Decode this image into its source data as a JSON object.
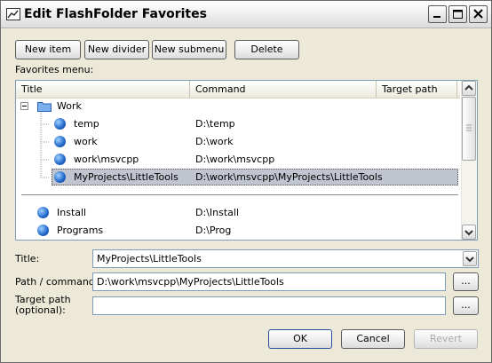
{
  "window": {
    "title": "Edit FlashFolder Favorites"
  },
  "toolbar": {
    "new_item": "New item",
    "new_divider": "New divider",
    "new_submenu": "New submenu",
    "delete": "Delete"
  },
  "favorites_label": "Favorites menu:",
  "list": {
    "columns": [
      "Title",
      "Command",
      "Target path"
    ],
    "rows": [
      {
        "title": "Work",
        "command": "",
        "type": "folder",
        "level": 0,
        "expanded": true
      },
      {
        "title": "temp",
        "command": "D:\\temp",
        "type": "item",
        "level": 1
      },
      {
        "title": "work",
        "command": "D:\\work",
        "type": "item",
        "level": 1
      },
      {
        "title": "work\\msvcpp",
        "command": "D:\\work\\msvcpp",
        "type": "item",
        "level": 1
      },
      {
        "title": "MyProjects\\LittleTools",
        "command": "D:\\work\\msvcpp\\MyProjects\\LittleTools",
        "type": "item",
        "level": 1,
        "selected": true
      },
      {
        "title": "",
        "command": "",
        "type": "divider",
        "level": 0
      },
      {
        "title": "Install",
        "command": "D:\\Install",
        "type": "item",
        "level": 0
      },
      {
        "title": "Programs",
        "command": "D:\\Prog",
        "type": "item",
        "level": 0
      }
    ]
  },
  "form": {
    "title_label": "Title:",
    "title_value": "MyProjects\\LittleTools",
    "path_label": "Path / command:",
    "path_value": "D:\\work\\msvcpp\\MyProjects\\LittleTools",
    "target_label_1": "Target path",
    "target_label_2": "(optional):",
    "target_value": "",
    "browse": "..."
  },
  "buttons": {
    "ok": "OK",
    "cancel": "Cancel",
    "revert": "Revert"
  },
  "colors": {
    "selection": "#c1c5cf",
    "accent": "#1f66c9"
  }
}
